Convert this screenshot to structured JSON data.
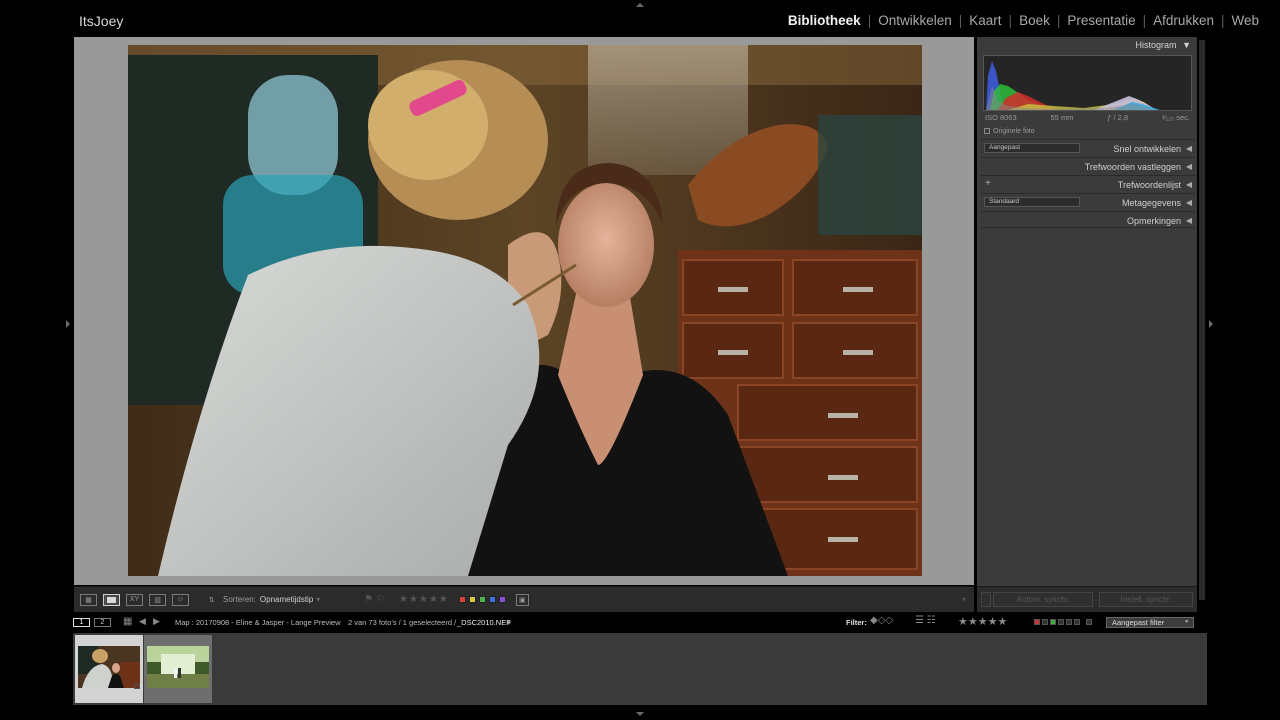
{
  "identity_plate": "ItsJoey",
  "modules": [
    "Bibliotheek",
    "Ontwikkelen",
    "Kaart",
    "Boek",
    "Presentatie",
    "Afdrukken",
    "Web"
  ],
  "active_module": "Bibliotheek",
  "toolbar": {
    "sort_label": "Sorteren:",
    "sort_value": "Opnametijdstip",
    "stars": "★★★★★",
    "color_labels": [
      "#d9423a",
      "#d9c93a",
      "#4fb24f",
      "#3f6fd9",
      "#8c4fd9"
    ]
  },
  "right_panel": {
    "histogram_title": "Histogram",
    "exif": {
      "iso": "ISO 8063",
      "focal": "55 mm",
      "aperture": "ƒ / 2,8",
      "shutter": "¹⁄₁₂₅ sec."
    },
    "original_photo": "Originele foto",
    "sections": [
      {
        "label": "Snel ontwikkelen",
        "dropdown": "Aangepast"
      },
      {
        "label": "Trefwoorden vastleggen"
      },
      {
        "label": "Trefwoordenlijst",
        "plus": "+"
      },
      {
        "label": "Metagegevens",
        "dropdown": "Standaard"
      },
      {
        "label": "Opmerkingen"
      }
    ],
    "sync_metadata": "Autom. synchr.",
    "sync_settings": "Instell. synchr."
  },
  "filmstrip_header": {
    "screen1": "1",
    "screen2": "2",
    "path": "Map : 20170908 - Eline & Jasper - Lange Preview",
    "count_text": "2 van 73 foto's / 1 geselecteerd /",
    "filename": "_DSC2010.NEF",
    "filter_label": "Filter:",
    "stars": "★★★★★",
    "filter_preset": "Aangepast filter"
  },
  "filmstrip": {
    "thumbnail_count": 2,
    "selected_index": 0
  }
}
